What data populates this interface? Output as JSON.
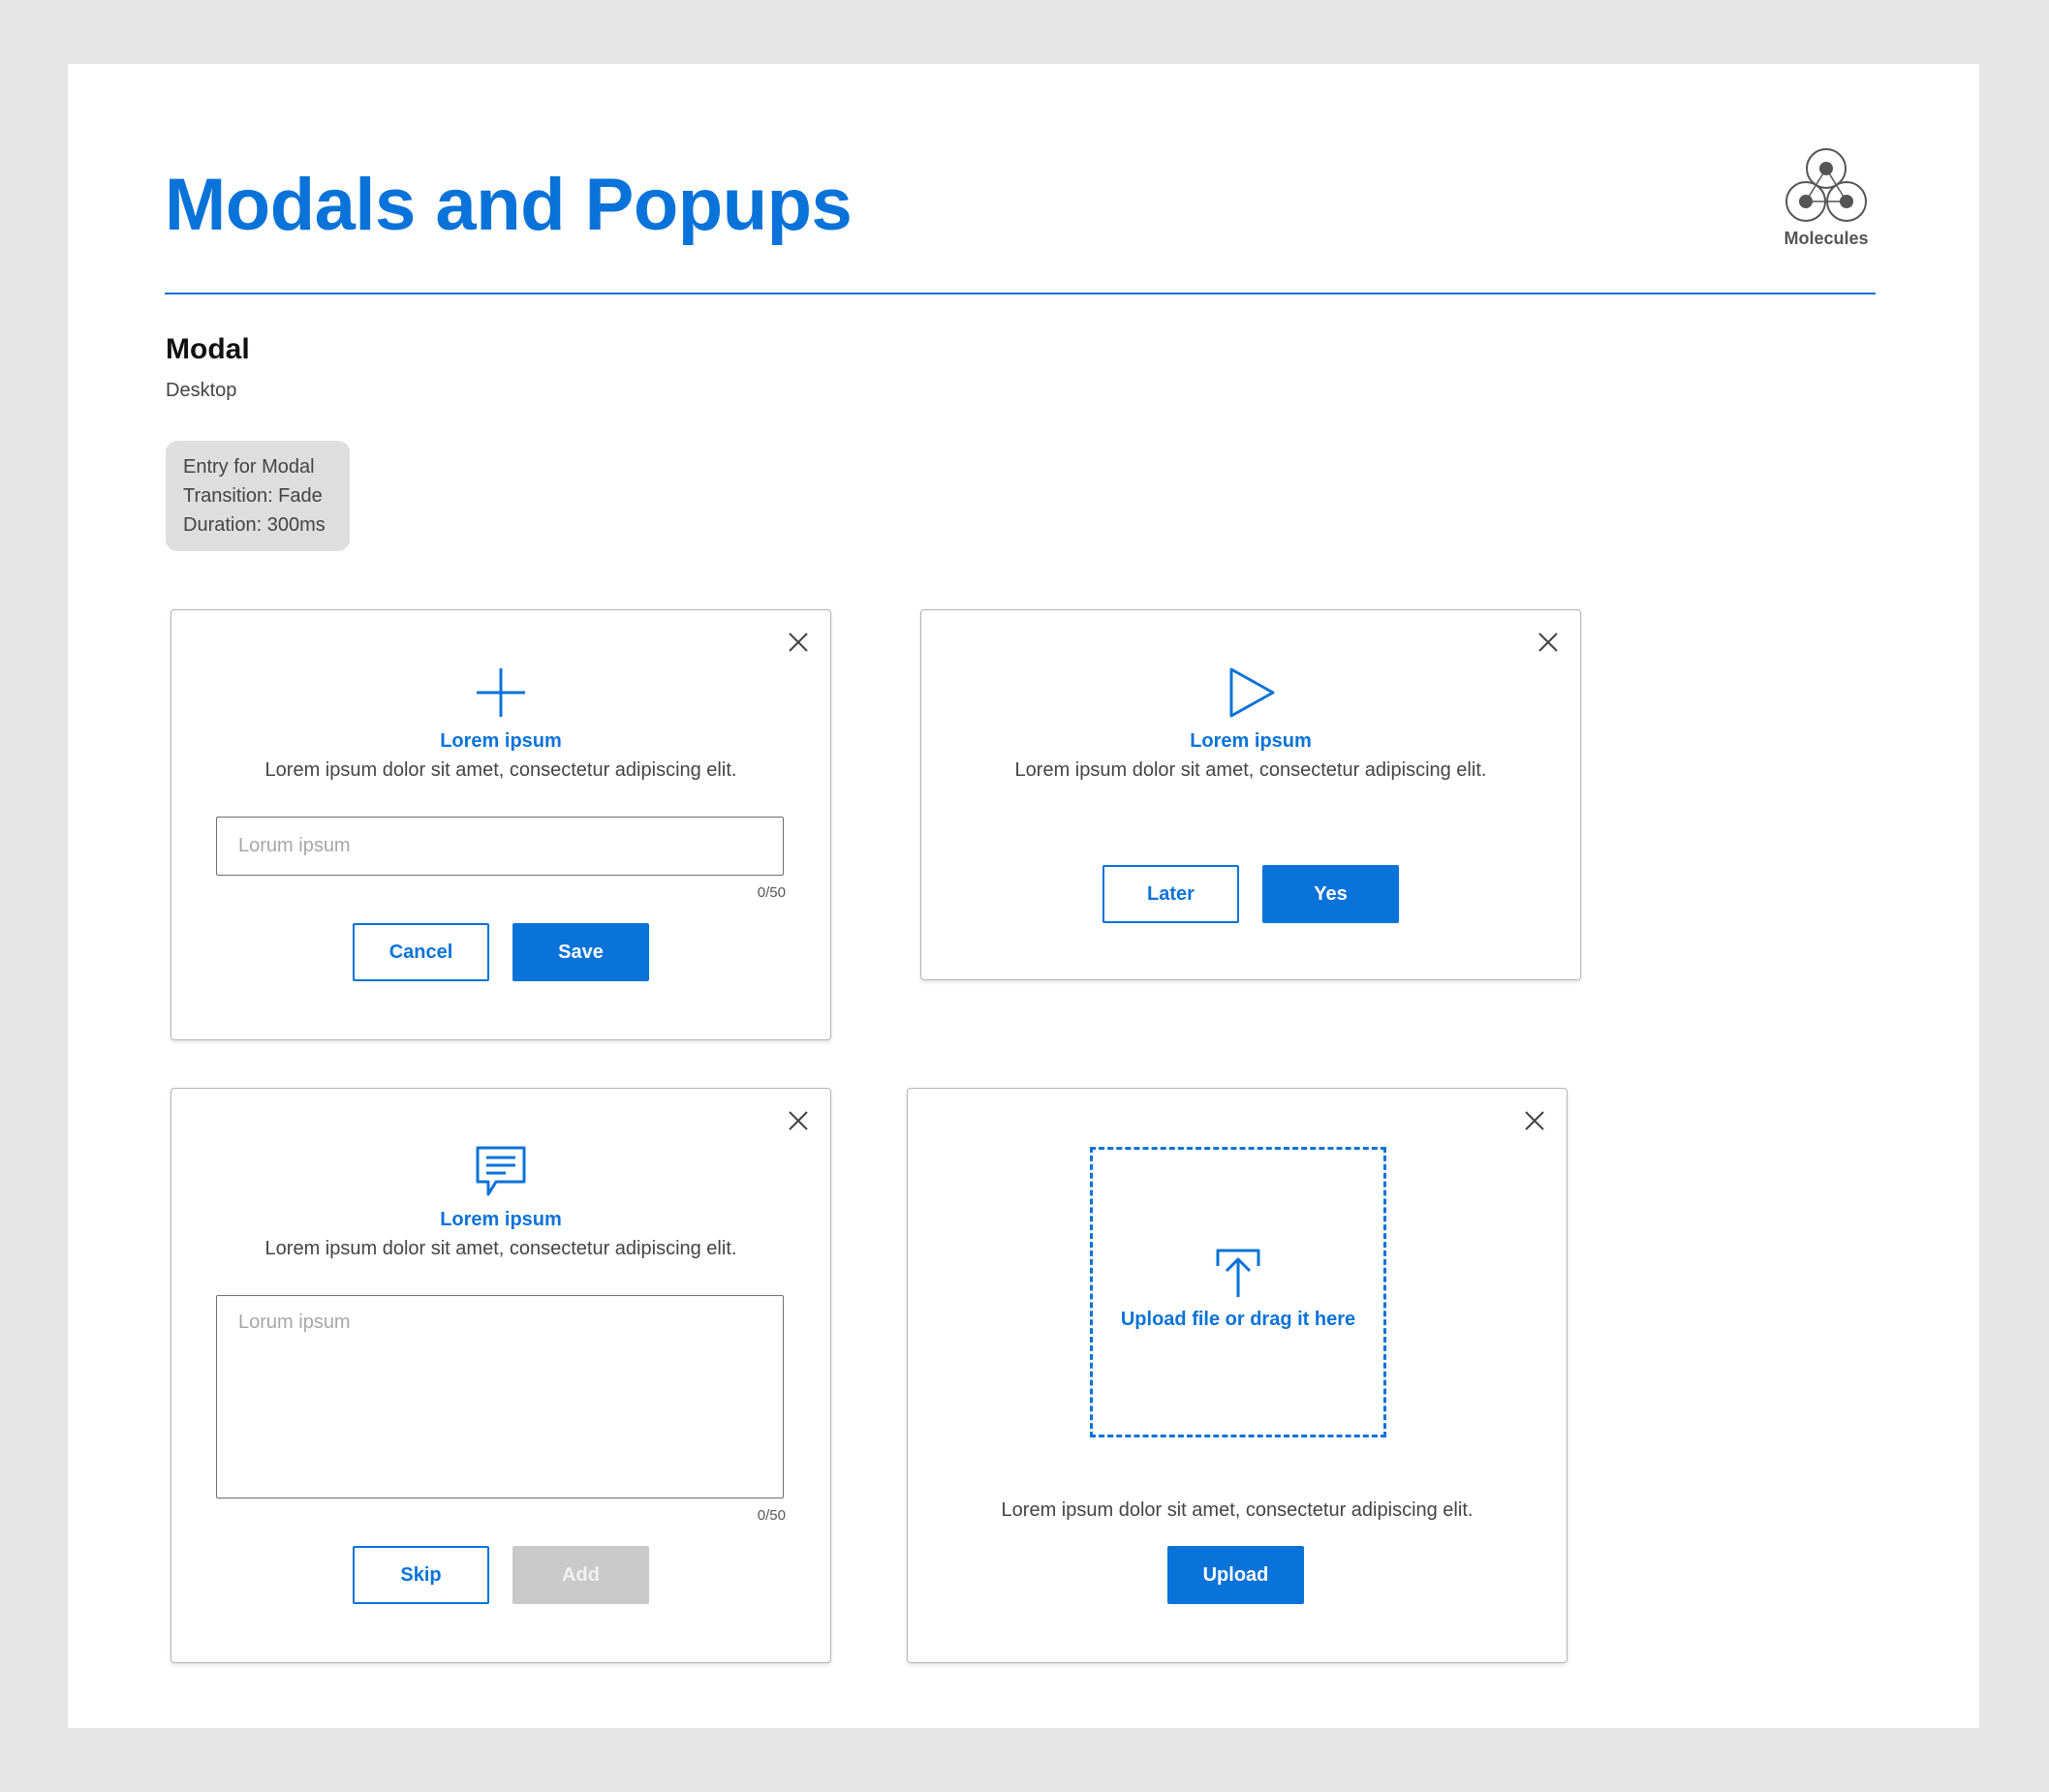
{
  "page": {
    "title": "Modals and Popups",
    "badge_label": "Molecules"
  },
  "section": {
    "title": "Modal",
    "subtitle": "Desktop"
  },
  "note": {
    "line1": "Entry for Modal",
    "line2": "Transition: Fade",
    "line3": "Duration: 300ms"
  },
  "colors": {
    "accent": "#0a73d9",
    "disabled": "#c9c9c9",
    "background": "#e6e6e6"
  },
  "modals": [
    {
      "icon": "plus-icon",
      "title": "Lorem ipsum",
      "description": "Lorem ipsum dolor sit amet, consectetur adipiscing elit.",
      "input_placeholder": "Lorum ipsum",
      "counter": "0/50",
      "secondary_label": "Cancel",
      "primary_label": "Save"
    },
    {
      "icon": "play-icon",
      "title": "Lorem ipsum",
      "description": "Lorem ipsum dolor sit amet, consectetur adipiscing elit.",
      "secondary_label": "Later",
      "primary_label": "Yes"
    },
    {
      "icon": "chat-bubble-icon",
      "title": "Lorem ipsum",
      "description": "Lorem ipsum dolor sit amet, consectetur adipiscing elit.",
      "input_placeholder": "Lorum ipsum",
      "counter": "0/50",
      "secondary_label": "Skip",
      "primary_label": "Add",
      "primary_disabled": true
    },
    {
      "icon": "upload-icon",
      "dropzone_label": "Upload file or drag it here",
      "description": "Lorem ipsum dolor sit amet, consectetur adipiscing elit.",
      "primary_label": "Upload"
    }
  ]
}
